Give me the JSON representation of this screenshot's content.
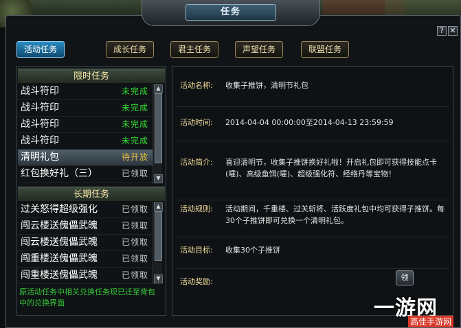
{
  "window": {
    "title": "任务",
    "help_label": "?",
    "close_label": "✕"
  },
  "tabs": [
    {
      "label": "活动任务",
      "active": true
    },
    {
      "label": "成长任务",
      "active": false
    },
    {
      "label": "君主任务",
      "active": false
    },
    {
      "label": "声望任务",
      "active": false
    },
    {
      "label": "联盟任务",
      "active": false
    }
  ],
  "limited_section": {
    "header": "限时任务",
    "items": [
      {
        "name": "战斗符印",
        "status": "未完成"
      },
      {
        "name": "战斗符印",
        "status": "未完成"
      },
      {
        "name": "战斗符印",
        "status": "未完成"
      },
      {
        "name": "战斗符印",
        "status": "未完成"
      },
      {
        "name": "清明礼包",
        "status": "待开放",
        "selected": true
      },
      {
        "name": "红包换好礼（三）",
        "status": "已领取"
      }
    ]
  },
  "long_section": {
    "header": "长期任务",
    "items": [
      {
        "name": "过关怒得超级强化",
        "status": "已领取"
      },
      {
        "name": "闯云楼送傀儡武魄",
        "status": "已领取"
      },
      {
        "name": "闯云楼送傀儡武魄",
        "status": "已领取"
      },
      {
        "name": "闯重楼送傀儡武魄",
        "status": "已领取"
      },
      {
        "name": "闯重楼送傀儡武魄",
        "status": "已领取"
      }
    ]
  },
  "note": "原活动任务中相关兑换任务现已迁至背包中的兑换界面",
  "details": {
    "name_label": "活动名称:",
    "name_value": "收集子推饼，清明节礼包",
    "time_label": "活动时间:",
    "time_value": "2014-04-04 00:00:00至2014-04-13 23:59:59",
    "intro_label": "活动简介:",
    "intro_value": "喜迎清明节，收集子推饼换好礼啦！开启礼包即可获得技能点卡(嚯)、高级鱼饵(嚯)、超级强化符、经络丹等宝物！",
    "rules_label": "活动规则:",
    "rules_value": "活动期间，千重楼、过关斩将、活跃度礼包中均可获得子推饼。每30个子推饼即可兑换一个清明礼包。",
    "target_label": "活动目标:",
    "target_value": "收集30个子推饼",
    "reward_label": "活动奖励:",
    "claim_button": "领"
  },
  "watermark": {
    "main": "一游网",
    "sub": "高佳手游网"
  }
}
